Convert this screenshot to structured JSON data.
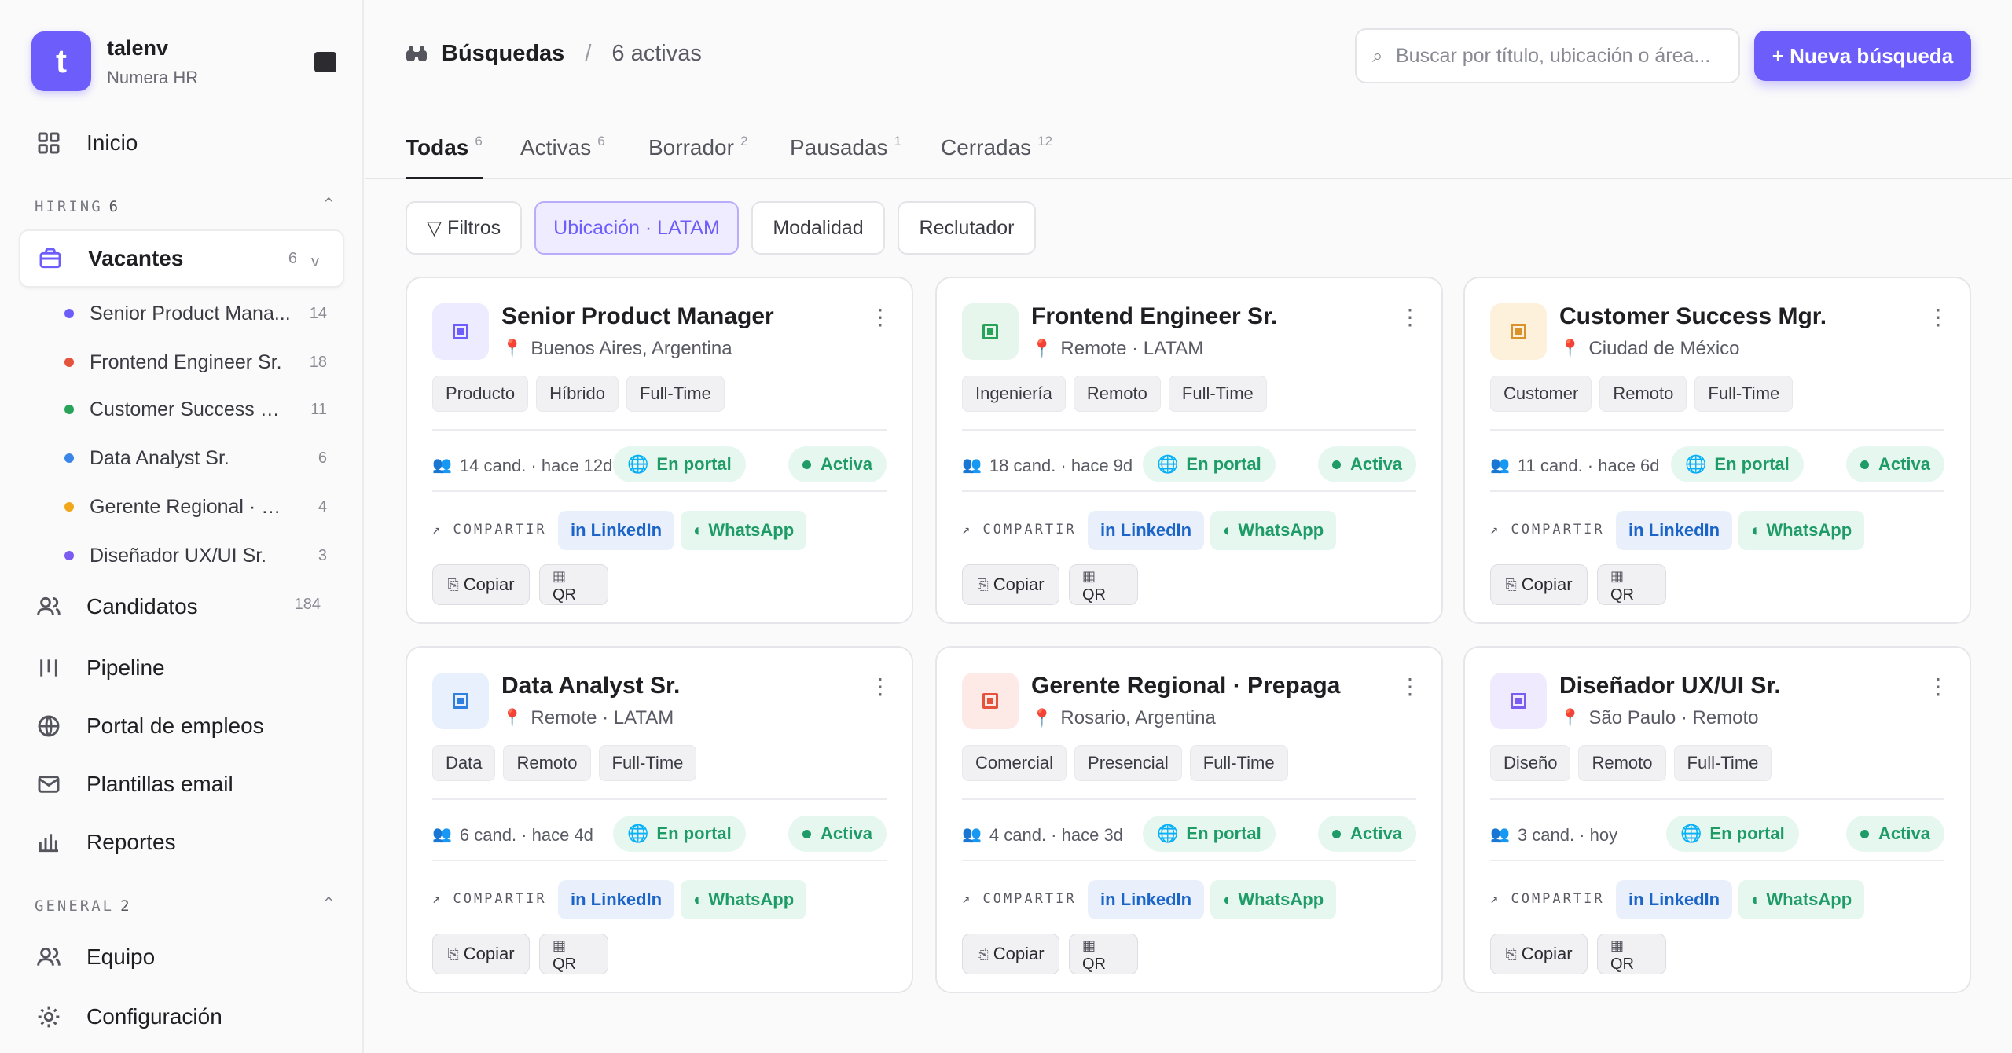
{
  "workspace": {
    "initial": "t",
    "name": "talenv",
    "org": "Numera HR"
  },
  "nav": {
    "home": "Inicio",
    "hiring_section": {
      "label": "HIRING",
      "count": "6"
    },
    "vacantes": {
      "label": "Vacantes",
      "count": "6"
    },
    "vacancies": [
      {
        "title": "Senior Product Mana...",
        "count": "14",
        "color": "#6d5efc"
      },
      {
        "title": "Frontend Engineer Sr.",
        "count": "18",
        "color": "#e5533d"
      },
      {
        "title": "Customer Success Mgr.",
        "count": "11",
        "color": "#2aa35a"
      },
      {
        "title": "Data Analyst Sr.",
        "count": "6",
        "color": "#3a86e8"
      },
      {
        "title": "Gerente Regional · Pre...",
        "count": "4",
        "color": "#f0a81a"
      },
      {
        "title": "Diseñador UX/UI Sr.",
        "count": "3",
        "color": "#7b5cf0"
      }
    ],
    "candidatos": {
      "label": "Candidatos",
      "count": "184"
    },
    "pipeline": "Pipeline",
    "portal": "Portal de empleos",
    "plantillas": "Plantillas email",
    "reportes": "Reportes",
    "general_section": {
      "label": "GENERAL",
      "count": "2"
    },
    "equipo": "Equipo",
    "config": "Configuración"
  },
  "header": {
    "title": "Búsquedas",
    "separator": "/",
    "subtitle": "6 activas",
    "search_placeholder": "Buscar por título, ubicación o área...",
    "new_button": "+ Nueva búsqueda"
  },
  "tabs": [
    {
      "label": "Todas",
      "count": "6"
    },
    {
      "label": "Activas",
      "count": "6"
    },
    {
      "label": "Borrador",
      "count": "2"
    },
    {
      "label": "Pausadas",
      "count": "1"
    },
    {
      "label": "Cerradas",
      "count": "12"
    }
  ],
  "filters": {
    "filtros": "▽ Filtros",
    "ubicacion": "Ubicación · LATAM",
    "modalidad": "Modalidad",
    "reclutador": "Reclutador"
  },
  "card_labels": {
    "portal": "En portal",
    "status": "Activa",
    "share": "↗ COMPARTIR",
    "linkedin": "in LinkedIn",
    "whatsapp": "◐ WhatsApp",
    "copy": "Copiar",
    "qr": "QR"
  },
  "cards": [
    {
      "title": "Senior Product Manager",
      "location": "Buenos Aires, Argentina",
      "tags": [
        "Producto",
        "Híbrido",
        "Full-Time"
      ],
      "meta": "14 cand. · hace 12d",
      "icon_bg": "#ecebff",
      "icon_color": "#6d5efc"
    },
    {
      "title": "Frontend Engineer Sr.",
      "location": "Remote · LATAM",
      "tags": [
        "Ingeniería",
        "Remoto",
        "Full-Time"
      ],
      "meta": "18 cand. · hace 9d",
      "icon_bg": "#e6f6ec",
      "icon_color": "#2aa35a"
    },
    {
      "title": "Customer Success Mgr.",
      "location": "Ciudad de México",
      "tags": [
        "Customer",
        "Remoto",
        "Full-Time"
      ],
      "meta": "11 cand. · hace 6d",
      "icon_bg": "#fdf1dc",
      "icon_color": "#d9932a"
    },
    {
      "title": "Data Analyst Sr.",
      "location": "Remote · LATAM",
      "tags": [
        "Data",
        "Remoto",
        "Full-Time"
      ],
      "meta": "6 cand. · hace 4d",
      "icon_bg": "#e7f0fc",
      "icon_color": "#2f7fe0"
    },
    {
      "title": "Gerente Regional · Prepaga",
      "location": "Rosario, Argentina",
      "tags": [
        "Comercial",
        "Presencial",
        "Full-Time"
      ],
      "meta": "4 cand. · hace 3d",
      "icon_bg": "#fde9e6",
      "icon_color": "#e5533d"
    },
    {
      "title": "Diseñador UX/UI Sr.",
      "location": "São Paulo · Remoto",
      "tags": [
        "Diseño",
        "Remoto",
        "Full-Time"
      ],
      "meta": "3 cand. · hoy",
      "icon_bg": "#efeafe",
      "icon_color": "#7b5cf0"
    }
  ]
}
